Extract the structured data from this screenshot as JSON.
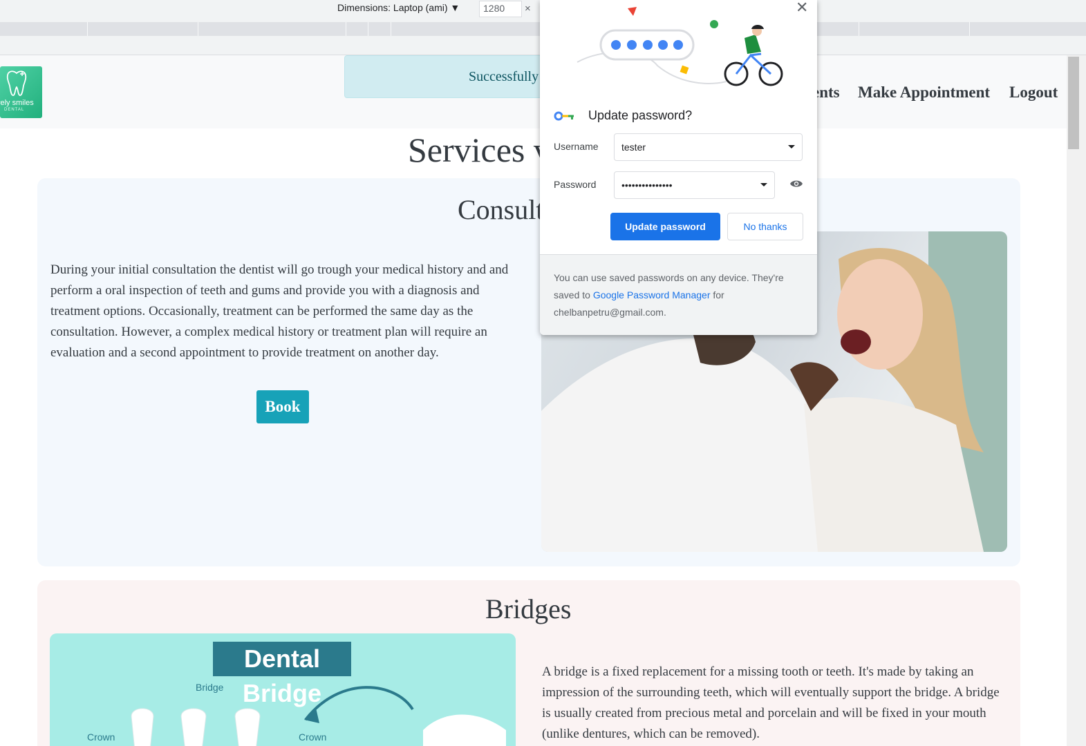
{
  "devtools": {
    "dimensions_label": "Dimensions: Laptop (ami) ▼",
    "width_value": "1280",
    "close_glyph": "×"
  },
  "navbar": {
    "logo_text": "vely smiles",
    "logo_sub": "DENTAL",
    "alert_text": "Successfully",
    "links": [
      "ents",
      "Make Appointment",
      "Logout"
    ]
  },
  "page": {
    "title": "Services v",
    "consultation": {
      "title": "Consult",
      "text": "During your initial consultation the dentist will go trough your medical history and and perform a oral inspection of teeth and gums and provide you with a diagnosis and treatment options. Occasionally, treatment can be performed the same day as the consultation. However, a complex medical history or treatment plan will require an evaluation and a second appointment to provide treatment on another day.",
      "book_label": "Book"
    },
    "bridges": {
      "title": "Bridges",
      "image_banner": "Dental Bridge",
      "image_labels": [
        "Bridge",
        "Crown",
        "Crown"
      ],
      "text": "A bridge is a fixed replacement for a missing tooth or teeth. It's made by taking an impression of the surrounding teeth, which will eventually support the bridge. A bridge is usually created from precious metal and porcelain and will be fixed in your mouth (unlike dentures, which can be removed)."
    }
  },
  "password_popup": {
    "close_glyph": "✕",
    "title": "Update password?",
    "username_label": "Username",
    "username_value": "tester",
    "password_label": "Password",
    "password_value": "•••••••••••••••",
    "update_button": "Update password",
    "no_thanks_button": "No thanks",
    "footer_prefix": "You can use saved passwords on any device. They're saved to ",
    "footer_link": "Google Password Manager",
    "footer_suffix": " for",
    "footer_email": "chelbanpetru@gmail.com."
  },
  "colors": {
    "accent": "#1a73e8",
    "book_button": "#17a2b8",
    "alert_bg": "#d1ecf1"
  }
}
